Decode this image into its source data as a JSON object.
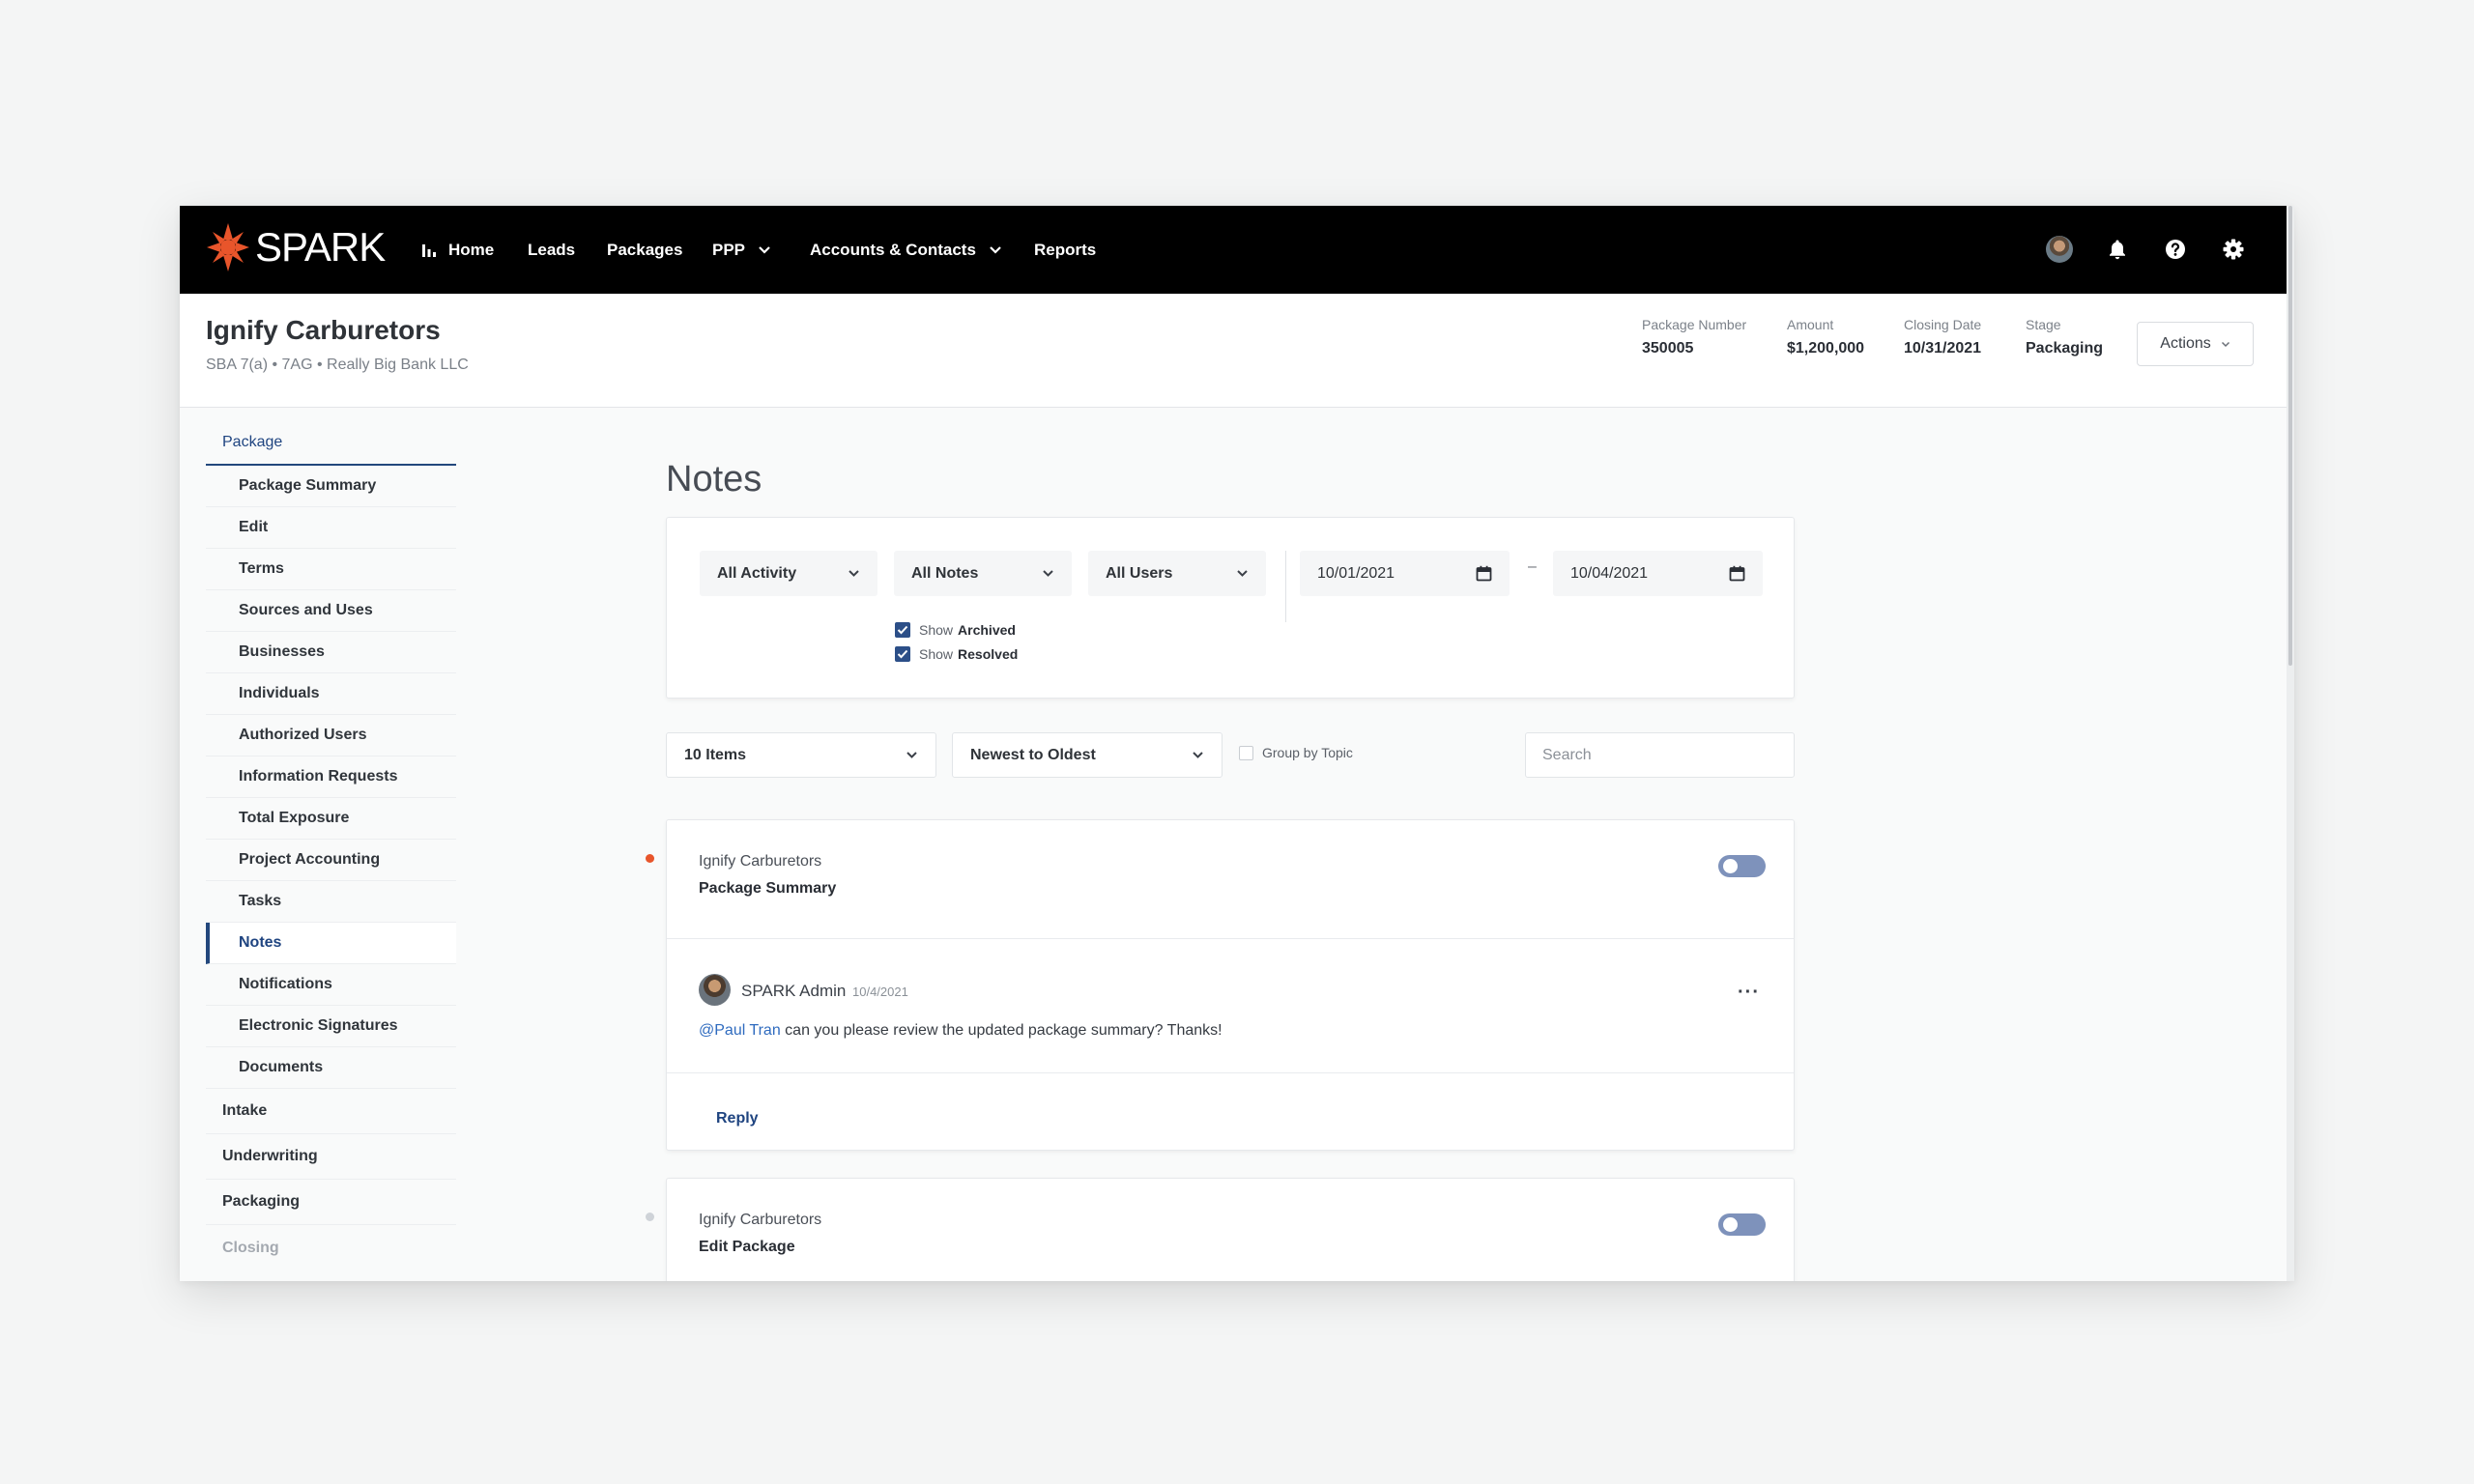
{
  "app": {
    "logo_text": "SPARK",
    "nav": [
      {
        "label": "Home"
      },
      {
        "label": "Leads"
      },
      {
        "label": "Packages"
      },
      {
        "label": "PPP"
      },
      {
        "label": "Accounts & Contacts"
      },
      {
        "label": "Reports"
      }
    ],
    "icons": [
      "bar-chart-icon",
      "avatar",
      "bell-icon",
      "help-icon",
      "gear-icon"
    ]
  },
  "header": {
    "title": "Ignify Carburetors",
    "subtitle": "SBA 7(a) • 7AG • Really Big Bank LLC",
    "meta": [
      {
        "label": "Package Number",
        "value": "350005"
      },
      {
        "label": "Amount",
        "value": "$1,200,000"
      },
      {
        "label": "Closing Date",
        "value": "10/31/2021"
      },
      {
        "label": "Stage",
        "value": "Packaging"
      }
    ],
    "actions_label": "Actions"
  },
  "sidebar": {
    "section_title": "Package",
    "items": [
      {
        "label": "Package Summary"
      },
      {
        "label": "Edit"
      },
      {
        "label": "Terms"
      },
      {
        "label": "Sources and Uses"
      },
      {
        "label": "Businesses"
      },
      {
        "label": "Individuals"
      },
      {
        "label": "Authorized Users"
      },
      {
        "label": "Information Requests"
      },
      {
        "label": "Total Exposure"
      },
      {
        "label": "Project Accounting"
      },
      {
        "label": "Tasks"
      },
      {
        "label": "Notes"
      },
      {
        "label": "Notifications"
      },
      {
        "label": "Electronic Signatures"
      },
      {
        "label": "Documents"
      }
    ],
    "active_item": "Notes",
    "sections": [
      {
        "label": "Intake"
      },
      {
        "label": "Underwriting"
      },
      {
        "label": "Packaging"
      },
      {
        "label": "Closing"
      }
    ]
  },
  "main": {
    "title": "Notes",
    "filters": {
      "activity": "All Activity",
      "notes": "All Notes",
      "users": "All Users",
      "date_from": "10/01/2021",
      "date_sep": "–",
      "date_to": "10/04/2021",
      "show_label": "Show",
      "archived_label": "Archived",
      "resolved_label": "Resolved",
      "show_archived": true,
      "show_resolved": true
    },
    "controls": {
      "page_size": "10 Items",
      "sort": "Newest to Oldest",
      "group_by_label": "Group by Topic",
      "group_by": false,
      "search_placeholder": "Search"
    },
    "notes": [
      {
        "company": "Ignify Carburetors",
        "topic": "Package Summary",
        "unread_color": "#e8552b",
        "author": "SPARK Admin",
        "date": "10/4/2021",
        "mention": "@Paul Tran",
        "text": " can you please review the updated package summary? Thanks!",
        "more_label": "···",
        "reply_label": "Reply"
      },
      {
        "company": "Ignify Carburetors",
        "topic": "Edit Package",
        "unread_color": "#cfd3d8"
      }
    ]
  },
  "colors": {
    "nav_bg": "#000000",
    "accent": "#1f4480",
    "logo_orange": "#e8552b",
    "toggle": "#7e92bb",
    "mention": "#2f6bbf"
  }
}
